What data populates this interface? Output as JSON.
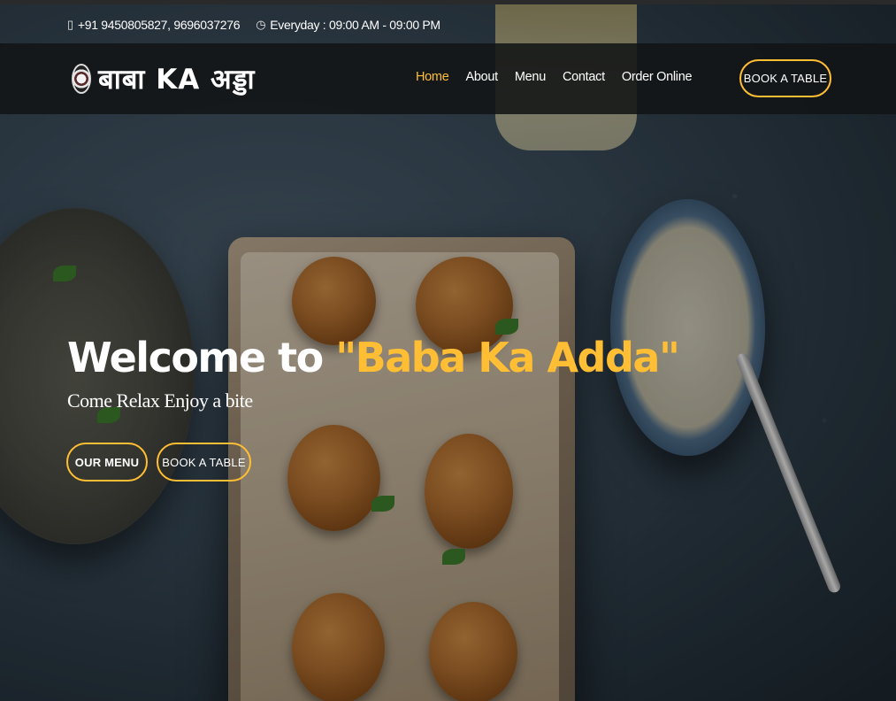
{
  "topbar": {
    "phone": "+91 9450805827, 9696037276",
    "hours": "Everyday : 09:00 AM - 09:00 PM",
    "phone_icon": "phone-icon",
    "clock_icon": "clock-icon"
  },
  "header": {
    "logo_text": "बाबा KA अड्डा",
    "nav": [
      {
        "label": "Home",
        "active": true
      },
      {
        "label": "About"
      },
      {
        "label": "Menu"
      },
      {
        "label": "Contact"
      },
      {
        "label": "Order Online"
      }
    ],
    "book_button": "BOOK A TABLE"
  },
  "hero": {
    "title_prefix": "Welcome to ",
    "title_accent": "\"Baba Ka Adda\"",
    "subtitle": "Come Relax Enjoy a bite",
    "menu_button": "OUR MENU",
    "book_button": "BOOK A TABLE"
  },
  "colors": {
    "accent": "#ffbe33",
    "header_bg": "#121416",
    "text": "#ffffff"
  }
}
